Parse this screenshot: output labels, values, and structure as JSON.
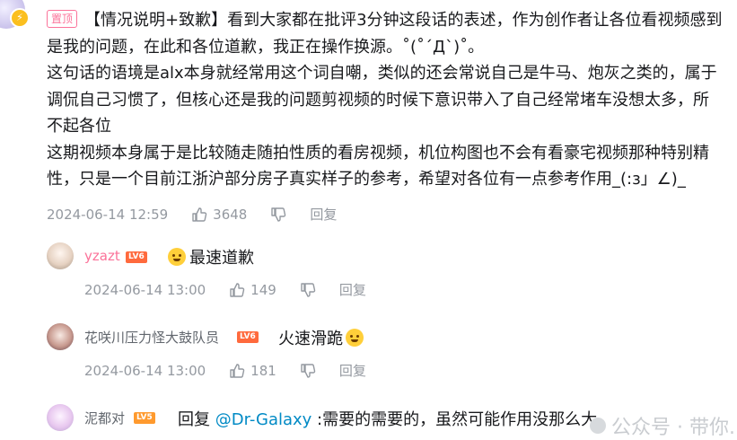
{
  "main_comment": {
    "pin_label": "置顶",
    "lines": [
      "【情况说明+致歉】看到大家都在批评3分钟这段话的表述，作为创作者让各位看视频感到",
      "是我的问题，在此和各位道歉，我正在操作换源。˚(˚´Д`)˚。",
      "这句话的语境是alx本身就经常用这个词自嘲，类似的还会常说自己是牛马、炮灰之类的，属于",
      "调侃自己习惯了，但核心还是我的问题剪视频的时候下意识带入了自己经常堵车没想太多，所",
      "不起各位",
      "这期视频本身属于是比较随走随拍性质的看房视频，机位构图也不会有看豪宅视频那种特别精",
      "性，只是一个目前江浙沪部分房子真实样子的参考，希望对各位有一点参考作用_(:з」∠)_"
    ],
    "date": "2024-06-14 12:59",
    "likes": "3648",
    "reply_label": "回复"
  },
  "replies": [
    {
      "username": "yzazt",
      "level": "LV6",
      "text": "最速道歉",
      "date": "2024-06-14 13:00",
      "likes": "149",
      "reply_label": "回复",
      "name_color": "#fb7299"
    },
    {
      "username": "花咲川压力怪大鼓队员",
      "level": "LV6",
      "text": "火速滑跪",
      "date": "2024-06-14 13:00",
      "likes": "181",
      "reply_label": "回复",
      "name_color": "#61666d"
    },
    {
      "username": "泥都对",
      "level": "LV5",
      "reply_prefix": "回复",
      "mention": "@Dr-Galaxy",
      "text": ":需要的需要的，虽然可能作用没那么大",
      "name_color": "#61666d"
    }
  ],
  "watermark": "公众号 · 带你..."
}
